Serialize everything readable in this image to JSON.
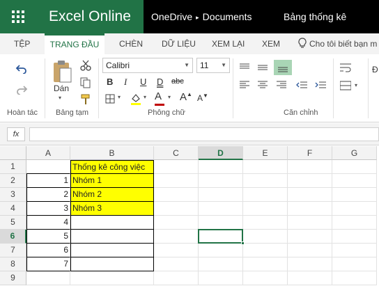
{
  "titlebar": {
    "app_name": "Excel Online",
    "breadcrumb": [
      "OneDrive",
      "Documents"
    ],
    "breadcrumb_separator": "▸",
    "document_title": "Bảng thống kê",
    "brand_color": "#217346"
  },
  "ribbon_tabs": [
    {
      "label": "TỆP"
    },
    {
      "label": "TRANG ĐẦU",
      "active": true
    },
    {
      "label": "CHÈN"
    },
    {
      "label": "DỮ LIỆU"
    },
    {
      "label": "XEM LẠI"
    },
    {
      "label": "XEM"
    }
  ],
  "tell_me": {
    "text": "Cho tôi biết bạn m"
  },
  "ribbon": {
    "undo_group_label": "Hoàn tác",
    "clipboard_group_label": "Bảng tạm",
    "paste_label": "Dán",
    "font_group_label": "Phông chữ",
    "font_name": "Calibri",
    "font_size": "11",
    "bold": "B",
    "italic": "I",
    "underline": "U",
    "double_underline": "D",
    "strikethrough": "abc",
    "font_color_letter": "A",
    "grow_font": "A",
    "shrink_font": "A",
    "alignment_group_label": "Căn chỉnh",
    "number_partial": "Đ"
  },
  "formula_bar": {
    "fx_label": "fx",
    "value": ""
  },
  "sheet": {
    "columns": [
      "A",
      "B",
      "C",
      "D",
      "E",
      "F",
      "G"
    ],
    "selected_column": "D",
    "rows": [
      "1",
      "2",
      "3",
      "4",
      "5",
      "6",
      "7",
      "8",
      "9"
    ],
    "selected_row": "6",
    "active_cell": "D6",
    "highlight_color": "#ffff00",
    "cells": {
      "B1": "Thống kê công việc",
      "A2": "1",
      "B2": "Nhóm 1",
      "A3": "2",
      "B3": "Nhóm 2",
      "A4": "3",
      "B4": "Nhóm 3",
      "A5": "4",
      "A6": "5",
      "A7": "6",
      "A8": "7"
    }
  }
}
